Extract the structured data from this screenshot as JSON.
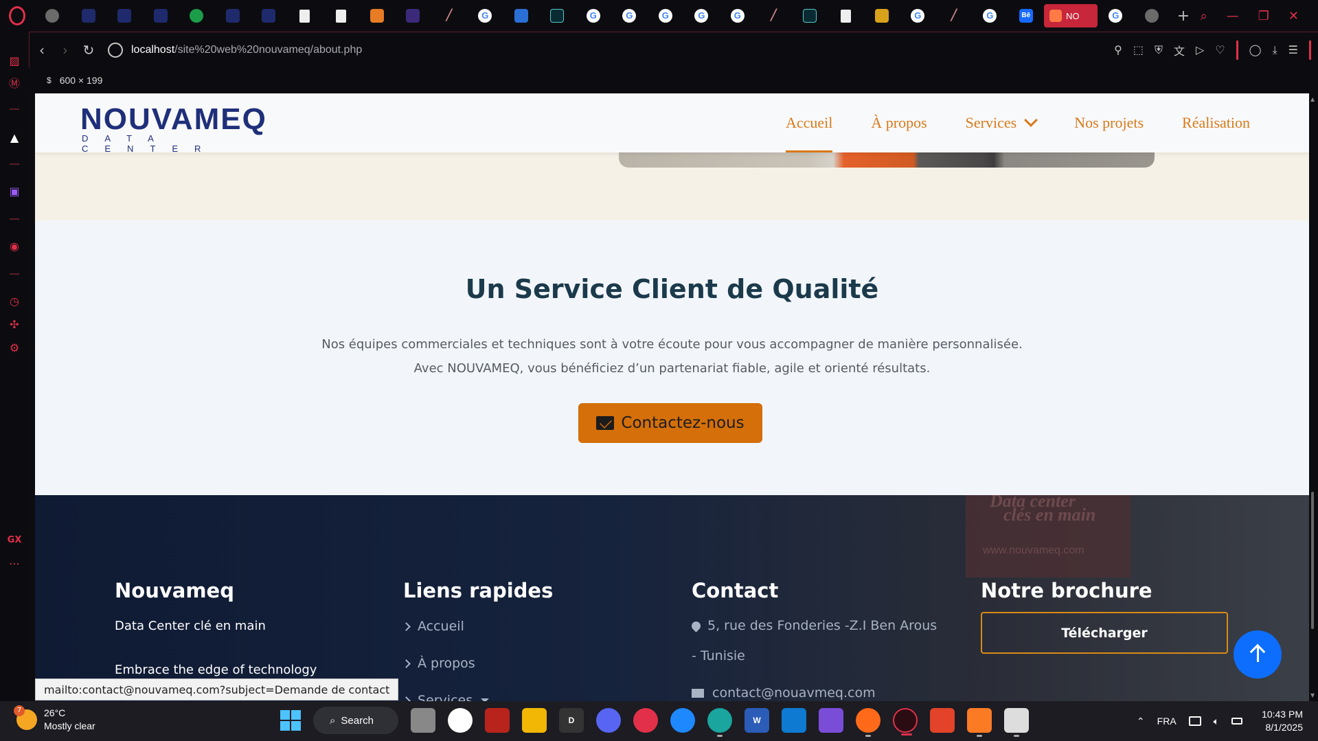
{
  "browser": {
    "active_tab_label": "NO",
    "url_host": "localhost",
    "url_path": "/site%20web%20nouvameq/about.php",
    "viewport_dims": "600 × 199",
    "status_link": "mailto:contact@nouvameq.com?subject=Demande de contact",
    "sidebar_label": "GX"
  },
  "site": {
    "logo_text": "NOUVAMEQ",
    "logo_subtitle": "DATA CENTER",
    "nav": [
      {
        "label": "Accueil",
        "active": true
      },
      {
        "label": "À propos"
      },
      {
        "label": "Services"
      },
      {
        "label": "Nos projets"
      },
      {
        "label": "Réalisation"
      }
    ]
  },
  "service_section": {
    "title": "Un Service Client de Qualité",
    "line1": "Nos équipes commerciales et techniques sont à votre écoute pour vous accompagner de manière personnalisée.",
    "line2": "Avec NOUVAMEQ, vous bénéficiez d’un partenariat fiable, agile et orienté résultats.",
    "cta_label": "Contactez-nous",
    "accent": "#d46f0a"
  },
  "footer": {
    "poster_line1": "Data center",
    "poster_line2": "clés en main",
    "poster_url": "www.nouvameq.com",
    "col1": {
      "title": "Nouvameq",
      "tagline": "Data Center clé en main",
      "slogan": "Embrace the edge of technology"
    },
    "col2": {
      "title": "Liens rapides",
      "links": [
        "Accueil",
        "À propos",
        "Services"
      ]
    },
    "col3": {
      "title": "Contact",
      "address": "5, rue des Fonderies -Z.I Ben Arous - Tunisie",
      "email": "contact@nouavmeq.com"
    },
    "col4": {
      "title": "Notre brochure",
      "download_label": "Télécharger"
    }
  },
  "taskbar": {
    "weather_temp": "26°C",
    "weather_desc": "Mostly clear",
    "weather_badge": "7",
    "search_label": "Search",
    "language": "FRA",
    "time": "10:43 PM",
    "date": "8/1/2025"
  }
}
